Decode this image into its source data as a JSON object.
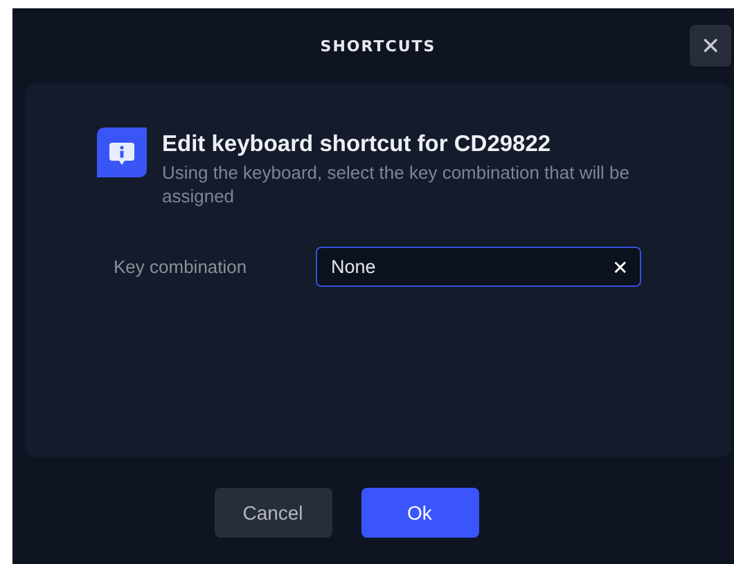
{
  "dialog": {
    "title": "SHORTCUTS",
    "close_icon": "✕"
  },
  "heading": "Edit keyboard shortcut for CD29822",
  "description": "Using the keyboard, select the key combination that will be assigned",
  "field": {
    "label": "Key combination",
    "value": "None",
    "clear_icon": "✕"
  },
  "buttons": [
    {
      "label": "Cancel",
      "kind": "secondary"
    },
    {
      "label": "Ok",
      "kind": "primary"
    }
  ]
}
